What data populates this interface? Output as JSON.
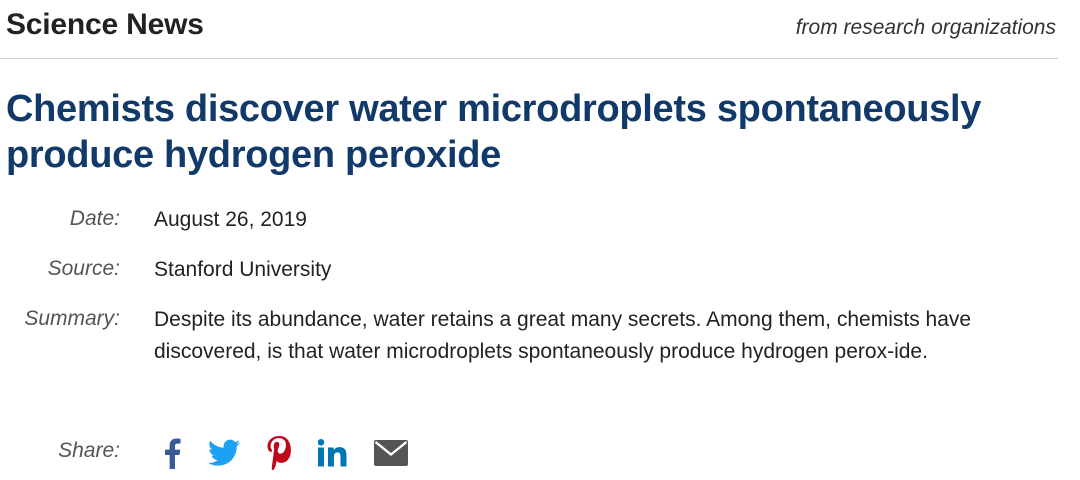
{
  "header": {
    "site_title": "Science News",
    "tagline": "from research organizations"
  },
  "article": {
    "headline": "Chemists discover water microdroplets spontaneously produce hydrogen peroxide",
    "date_label": "Date:",
    "date": "August 26, 2019",
    "source_label": "Source:",
    "source": "Stanford University",
    "summary_label": "Summary:",
    "summary": "Despite its abundance, water retains a great many secrets. Among them, chemists have discovered, is that water microdroplets spontaneously produce hydrogen perox-ide."
  },
  "share": {
    "label": "Share:",
    "icons": [
      "facebook-icon",
      "twitter-icon",
      "pinterest-icon",
      "linkedin-icon",
      "email-icon"
    ],
    "colors": {
      "facebook": "#3b5998",
      "twitter": "#1da1f2",
      "pinterest": "#bd081c",
      "linkedin": "#0077b5",
      "email": "#555555"
    }
  },
  "colors": {
    "headline": "#113a6b",
    "label": "#555555",
    "text": "#222222"
  }
}
